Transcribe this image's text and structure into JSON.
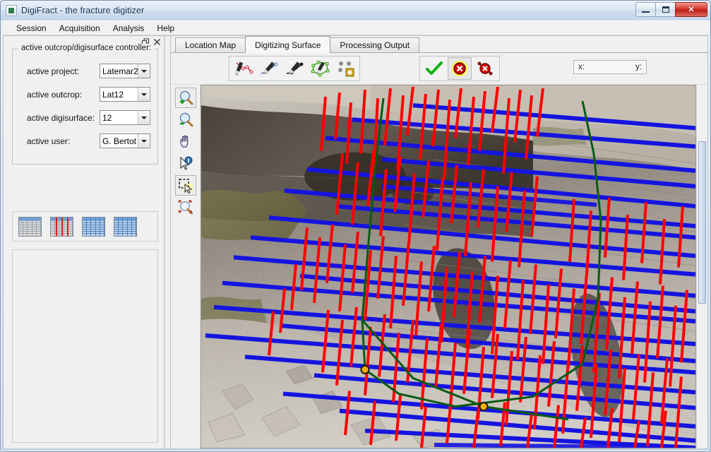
{
  "window": {
    "title": "DigiFract - the fracture digitizer",
    "app_icon": "app-icon",
    "minimize_label": "Minimize",
    "maximize_label": "Maximize",
    "close_label": "✕"
  },
  "menu": {
    "items": [
      {
        "label": "Session"
      },
      {
        "label": "Acquisition"
      },
      {
        "label": "Analysis"
      },
      {
        "label": "Help"
      }
    ]
  },
  "left_panel": {
    "header_buttons": [
      {
        "name": "float-panel-icon",
        "label": ""
      },
      {
        "name": "close-panel-icon",
        "label": ""
      }
    ],
    "controller": {
      "title": "active outcrop/digisurface controller:",
      "fields": [
        {
          "label": "active project:",
          "value": "Latemar2",
          "name": "active-project"
        },
        {
          "label": "active outcrop:",
          "value": "Lat12",
          "name": "active-outcrop"
        },
        {
          "label": "active digisurface:",
          "value": "12",
          "name": "active-digisurface"
        },
        {
          "label": "active user:",
          "value": "G. Bertot",
          "name": "active-user"
        }
      ]
    },
    "grid_buttons": [
      {
        "name": "table-all-icon",
        "style": "gray",
        "label": ""
      },
      {
        "name": "table-fractures-icon",
        "style": "gray-red",
        "label": ""
      },
      {
        "name": "table-beds-icon",
        "style": "blue",
        "label": ""
      },
      {
        "name": "table-segments-icon",
        "style": "blue",
        "label": ""
      }
    ]
  },
  "tabs": [
    {
      "label": "Location Map",
      "active": false,
      "name": "tab-location-map"
    },
    {
      "label": "Digitizing Surface",
      "active": true,
      "name": "tab-digitizing-surface"
    },
    {
      "label": "Processing Output",
      "active": false,
      "name": "tab-processing-output"
    }
  ],
  "toolbar": {
    "draw_tools": [
      {
        "name": "digitize-polyline-red-icon",
        "selected": false
      },
      {
        "name": "digitize-line-blue-icon",
        "selected": false
      },
      {
        "name": "digitize-line-black-icon",
        "selected": false
      },
      {
        "name": "digitize-polygon-green-icon",
        "selected": false
      },
      {
        "name": "digitize-points-icon",
        "selected": false
      }
    ],
    "action_tools": [
      {
        "name": "accept-check-icon",
        "selected": false
      },
      {
        "name": "cancel-x-icon",
        "selected": true
      },
      {
        "name": "delete-feature-icon",
        "selected": false
      }
    ],
    "coordinates": {
      "x_label": "x:",
      "y_label": "y:",
      "x_value": "",
      "y_value": ""
    }
  },
  "view_tools": [
    {
      "name": "zoom-in-icon",
      "selected": false
    },
    {
      "name": "zoom-out-icon",
      "selected": false
    },
    {
      "name": "pan-hand-icon",
      "selected": false
    },
    {
      "name": "identify-info-icon",
      "selected": false
    },
    {
      "name": "select-rect-icon",
      "selected": true
    },
    {
      "name": "zoom-extent-icon",
      "selected": false
    }
  ],
  "canvas": {
    "name": "digitizing-canvas",
    "colors": {
      "fracture": "#ff0000",
      "bedding": "#1414e0",
      "boundary": "#0a5a14",
      "vertex": "#ffb000",
      "rock_light": "#c9c2b8",
      "rock_dark": "#4a4139",
      "vegetation": "#6e6a40"
    },
    "bedding_line_count": 22,
    "fracture_line_count": 180,
    "scrollbar": {
      "name": "canvas-vertical-scrollbar"
    }
  }
}
